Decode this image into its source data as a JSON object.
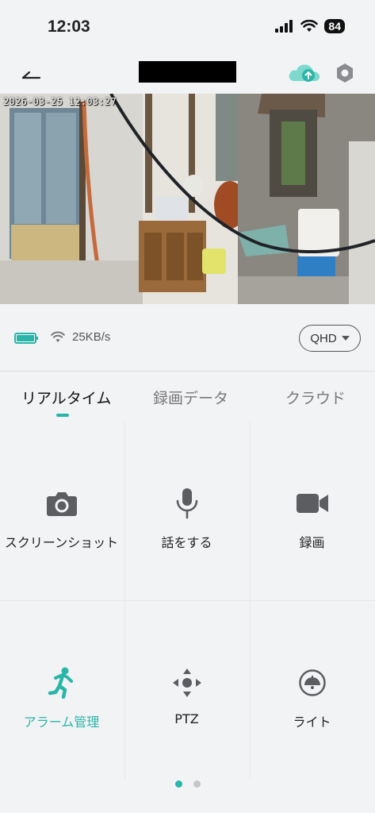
{
  "status_bar": {
    "time": "12:03",
    "battery": "84"
  },
  "header": {
    "title": "",
    "cloud_icon": "cloud-upload-icon",
    "settings_icon": "settings-hex-icon"
  },
  "video": {
    "timestamp": "2026-03-25 12:03:27"
  },
  "info": {
    "speed": "25KB/s",
    "quality": "QHD"
  },
  "tabs": [
    {
      "label": "リアルタイム"
    },
    {
      "label": "録画データ"
    },
    {
      "label": "クラウド"
    }
  ],
  "controls": [
    {
      "label": "スクリーンショット",
      "icon": "camera-icon"
    },
    {
      "label": "話をする",
      "icon": "microphone-icon"
    },
    {
      "label": "録画",
      "icon": "video-camera-icon"
    },
    {
      "label": "アラーム管理",
      "icon": "running-person-icon"
    },
    {
      "label": "PTZ",
      "icon": "ptz-dpad-icon"
    },
    {
      "label": "ライト",
      "icon": "lamp-icon"
    }
  ],
  "colors": {
    "accent": "#29b6a8",
    "background": "#f2f3f5"
  },
  "pager": {
    "pages": 2,
    "current": 1
  }
}
